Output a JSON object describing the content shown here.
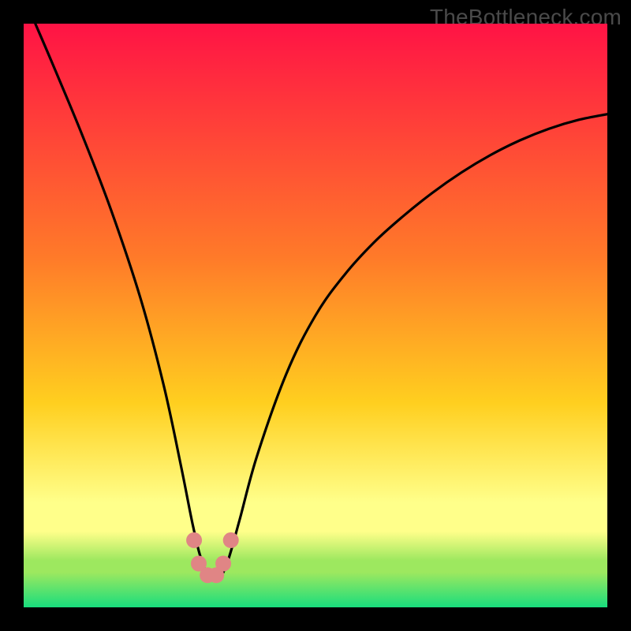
{
  "watermark": "TheBottleneck.com",
  "chart_data": {
    "type": "line",
    "title": "",
    "xlabel": "",
    "ylabel": "",
    "xlim": [
      0,
      100
    ],
    "ylim": [
      0,
      100
    ],
    "grid": false,
    "legend": false,
    "series": [
      {
        "name": "curve",
        "x": [
          2,
          5,
          10,
          15,
          20,
          24,
          27,
          29,
          30.5,
          32,
          33.5,
          35,
          37,
          40,
          45,
          50,
          55,
          60,
          65,
          70,
          75,
          80,
          85,
          90,
          95,
          100
        ],
        "y": [
          100,
          93,
          81,
          68,
          53,
          38,
          24,
          14,
          8,
          5,
          5,
          8,
          15,
          26,
          40,
          50,
          57,
          62.5,
          67,
          71,
          74.5,
          77.5,
          80,
          82,
          83.5,
          84.5
        ]
      }
    ],
    "markers": [
      {
        "x": 29.2,
        "y": 11.5,
        "color": "#e08585"
      },
      {
        "x": 30.0,
        "y": 7.5,
        "color": "#e08585"
      },
      {
        "x": 31.5,
        "y": 5.5,
        "color": "#e08585"
      },
      {
        "x": 33.0,
        "y": 5.5,
        "color": "#e08585"
      },
      {
        "x": 34.2,
        "y": 7.5,
        "color": "#e08585"
      },
      {
        "x": 35.5,
        "y": 11.5,
        "color": "#e08585"
      }
    ],
    "background_gradient": {
      "top": "#ff1345",
      "mid1": "#ff7a29",
      "mid2": "#ffcf1f",
      "band": "#ffff8a",
      "mid3": "#9de85f",
      "bottom": "#18dd7d"
    }
  }
}
